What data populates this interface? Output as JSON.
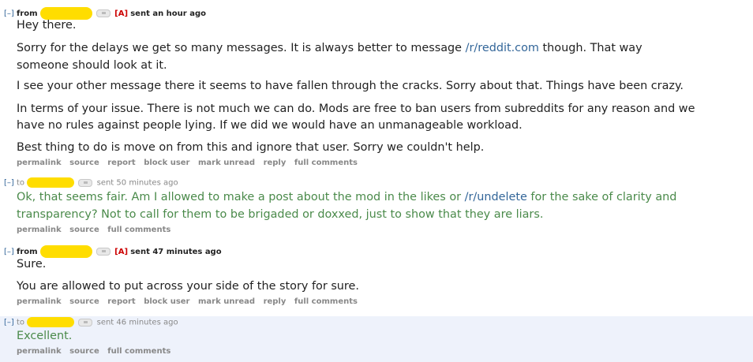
{
  "messages": [
    {
      "toggle": "[–]",
      "direction": "from",
      "admin": "[A]",
      "time": "sent an hour ago",
      "paragraphs": [
        "Hey there.",
        "Sorry for the delays we get so many messages. It is always better to message",
        "/r/reddit.com",
        "though. That way",
        "someone should look at it.",
        "I see your other message there it seems to have fallen through the cracks. Sorry about that. Things have been crazy.",
        "In terms of your issue. There is not much we can do. Mods are free to ban users from subreddits for any reason and we",
        "have no rules against people lying. If we did we would have an unmanageable workload.",
        "Best thing to do is move on from this and ignore that user. Sorry we couldn't help."
      ],
      "actions": [
        "permalink",
        "source",
        "report",
        "block user",
        "mark unread",
        "reply",
        "full comments"
      ]
    },
    {
      "toggle": "[–]",
      "direction": "to",
      "time": "sent 50 minutes ago",
      "paragraphs": [
        "Ok, that seems fair. Am I allowed to make a post about the mod in the likes or",
        "/r/undelete",
        "for the sake of clarity and",
        "transparency? Not to call for them to be brigaded or doxxed, just to show that they are liars."
      ],
      "actions": [
        "permalink",
        "source",
        "full comments"
      ]
    },
    {
      "toggle": "[–]",
      "direction": "from",
      "admin": "[A]",
      "time": "sent 47 minutes ago",
      "paragraphs": [
        "Sure.",
        "You are allowed to put across your side of the story for sure."
      ],
      "actions": [
        "permalink",
        "source",
        "report",
        "block user",
        "mark unread",
        "reply",
        "full comments"
      ]
    },
    {
      "toggle": "[–]",
      "direction": "to",
      "time": "sent 46 minutes ago",
      "paragraphs": [
        "Excellent."
      ],
      "actions": [
        "permalink",
        "source",
        "full comments"
      ]
    }
  ],
  "icons": {
    "mail": "mail-icon",
    "redaction": "redacted-username"
  },
  "colors": {
    "link": "#336699",
    "sent_text": "#4a8a4a",
    "admin": "#cc0000",
    "highlight": "#eef2fb",
    "redaction": "#ffdd00"
  }
}
